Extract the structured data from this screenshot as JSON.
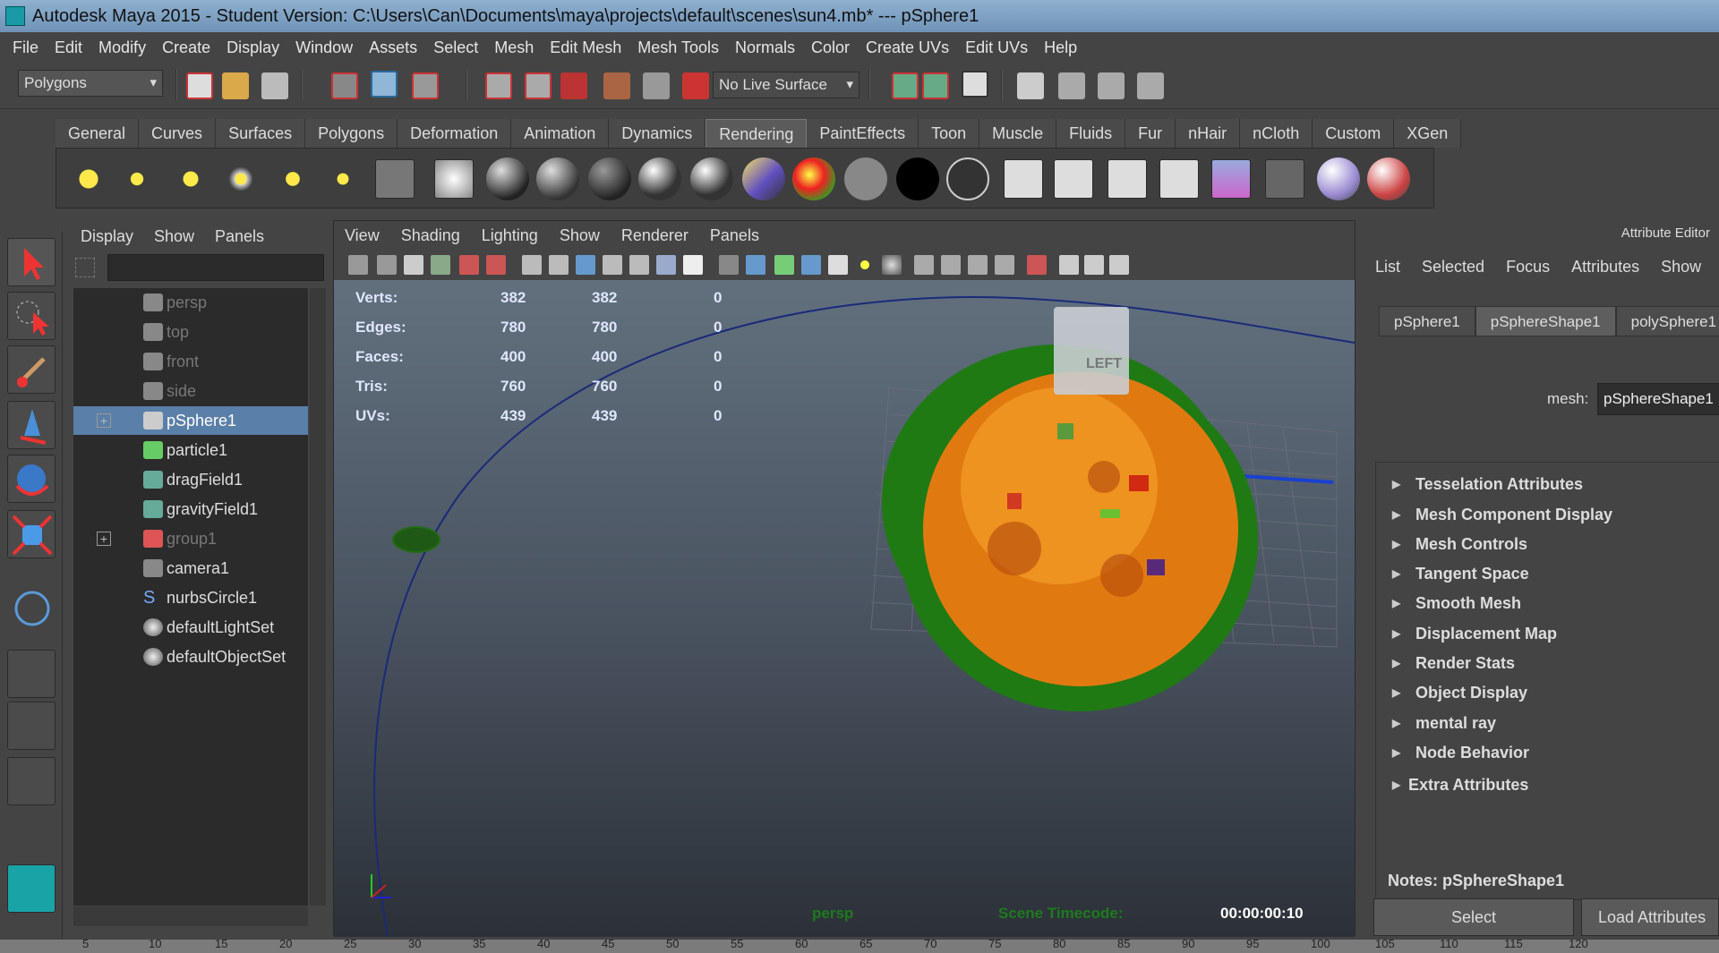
{
  "window": {
    "title": "Autodesk Maya 2015 - Student Version: C:\\Users\\Can\\Documents\\maya\\projects\\default\\scenes\\sun4.mb*  ---  pSphere1"
  },
  "menubar": [
    "File",
    "Edit",
    "Modify",
    "Create",
    "Display",
    "Window",
    "Assets",
    "Select",
    "Mesh",
    "Edit Mesh",
    "Mesh Tools",
    "Normals",
    "Color",
    "Create UVs",
    "Edit UVs",
    "Help"
  ],
  "statusline": {
    "menu_set": "Polygons",
    "live_surface": "No Live Surface"
  },
  "shelf": {
    "tabs": [
      "General",
      "Curves",
      "Surfaces",
      "Polygons",
      "Deformation",
      "Animation",
      "Dynamics",
      "Rendering",
      "PaintEffects",
      "Toon",
      "Muscle",
      "Fluids",
      "Fur",
      "nHair",
      "nCloth",
      "Custom",
      "XGen"
    ],
    "active_tab": "Rendering"
  },
  "outliner": {
    "menu": [
      "Display",
      "Show",
      "Panels"
    ],
    "items": [
      {
        "label": "persp",
        "type": "camera",
        "dim": true
      },
      {
        "label": "top",
        "type": "camera",
        "dim": true
      },
      {
        "label": "front",
        "type": "camera",
        "dim": true
      },
      {
        "label": "side",
        "type": "camera",
        "dim": true
      },
      {
        "label": "pSphere1",
        "type": "mesh",
        "selected": true,
        "expandable": true
      },
      {
        "label": "particle1",
        "type": "particle"
      },
      {
        "label": "dragField1",
        "type": "field"
      },
      {
        "label": "gravityField1",
        "type": "field"
      },
      {
        "label": "group1",
        "type": "group",
        "dim": true,
        "expandable": true
      },
      {
        "label": "camera1",
        "type": "camera"
      },
      {
        "label": "nurbsCircle1",
        "type": "curve"
      },
      {
        "label": "defaultLightSet",
        "type": "set"
      },
      {
        "label": "defaultObjectSet",
        "type": "set"
      }
    ]
  },
  "viewport": {
    "menu": [
      "View",
      "Shading",
      "Lighting",
      "Show",
      "Renderer",
      "Panels"
    ],
    "hud": {
      "rows": [
        {
          "label": "Verts:",
          "a": "382",
          "b": "382",
          "c": "0"
        },
        {
          "label": "Edges:",
          "a": "780",
          "b": "780",
          "c": "0"
        },
        {
          "label": "Faces:",
          "a": "400",
          "b": "400",
          "c": "0"
        },
        {
          "label": "Tris:",
          "a": "760",
          "b": "760",
          "c": "0"
        },
        {
          "label": "UVs:",
          "a": "439",
          "b": "439",
          "c": "0"
        }
      ]
    },
    "camera_name": "persp",
    "timecode_label": "Scene Timecode:",
    "timecode": "00:00:00:10",
    "viewcube_label": "LEFT"
  },
  "attribute_editor": {
    "title": "Attribute Editor",
    "menu": [
      "List",
      "Selected",
      "Focus",
      "Attributes",
      "Show"
    ],
    "tabs": [
      "pSphere1",
      "pSphereShape1",
      "polySphere1"
    ],
    "active_tab": "pSphereShape1",
    "mesh_label": "mesh:",
    "mesh_value": "pSphereShape1",
    "sections": [
      "Tesselation Attributes",
      "Mesh Component Display",
      "Mesh Controls",
      "Tangent Space",
      "Smooth Mesh",
      "Displacement Map",
      "Render Stats",
      "Object Display",
      "mental ray",
      "Node Behavior",
      "Extra Attributes"
    ],
    "notes": "Notes:  pSphereShape1",
    "buttons": {
      "select": "Select",
      "load": "Load Attributes"
    }
  },
  "timeslider": {
    "ticks": [
      "5",
      "10",
      "15",
      "20",
      "25",
      "30",
      "35",
      "40",
      "45",
      "50",
      "55",
      "60",
      "65",
      "70",
      "75",
      "80",
      "85",
      "90",
      "95",
      "100",
      "105",
      "110",
      "115",
      "120"
    ]
  }
}
